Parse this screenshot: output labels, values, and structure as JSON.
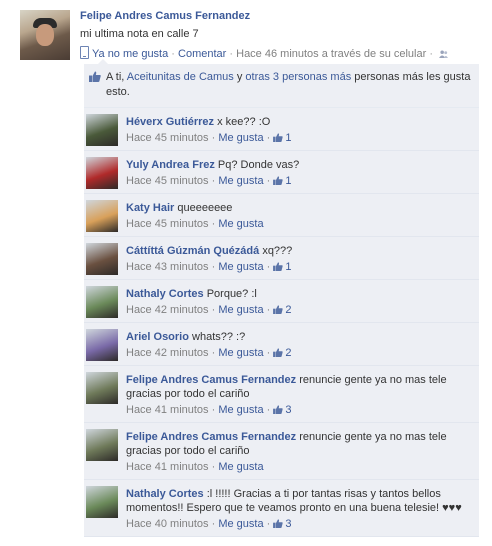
{
  "post": {
    "author": "Felipe Andres Camus Fernandez",
    "text": "mi ultima nota en calle 7",
    "unlike": "Ya no me gusta",
    "comment": "Comentar",
    "time": "Hace 46 minutos a través de su celular",
    "separator": "·"
  },
  "likes": {
    "you": "A ti,",
    "friend": "Aceitunitas de Camus",
    "and": "y",
    "others": "otras 3 personas más",
    "suffix": "personas más les gusta esto."
  },
  "comments": [
    {
      "name": "Héverx Gutiérrez",
      "text": "x kee?? :O",
      "time": "Hace 45 minutos",
      "like": "Me gusta",
      "count": "1",
      "avatar_color": "#4a5a3a"
    },
    {
      "name": "Yuly Andrea Frez",
      "text": "Pq? Donde vas?",
      "time": "Hace 45 minutos",
      "like": "Me gusta",
      "count": "1",
      "avatar_color": "#b02a2a"
    },
    {
      "name": "Katy Hair",
      "text": "queeeeeee",
      "time": "Hace 45 minutos",
      "like": "Me gusta",
      "count": "",
      "avatar_color": "#d8a05a"
    },
    {
      "name": "Cáttíttá Gúzmán Quézádá",
      "text": "xq???",
      "time": "Hace 43 minutos",
      "like": "Me gusta",
      "count": "1",
      "avatar_color": "#6a5040"
    },
    {
      "name": "Nathaly Cortes",
      "text": "Porque? :l",
      "time": "Hace 42 minutos",
      "like": "Me gusta",
      "count": "2",
      "avatar_color": "#6b8a5a"
    },
    {
      "name": "Ariel Osorio",
      "text": "whats?? :?",
      "time": "Hace 42 minutos",
      "like": "Me gusta",
      "count": "2",
      "avatar_color": "#7a6aa8"
    },
    {
      "name": "Felipe Andres Camus Fernandez",
      "text": "renuncie gente ya no mas tele gracias por todo el cariño",
      "time": "Hace 41 minutos",
      "like": "Me gusta",
      "count": "3",
      "avatar_color": "#6f7a5a"
    },
    {
      "name": "Felipe Andres Camus Fernandez",
      "text": "renuncie gente ya no mas tele gracias por todo el cariño",
      "time": "Hace 41 minutos",
      "like": "Me gusta",
      "count": "",
      "avatar_color": "#6f7a5a"
    },
    {
      "name": "Nathaly Cortes",
      "text": ":l !!!!! Gracias a ti por tantas risas y tantos bellos momentos!! Espero que te veamos pronto en una buena telesie! ♥♥♥",
      "time": "Hace 40 minutos",
      "like": "Me gusta",
      "count": "3",
      "avatar_color": "#6b8a5a"
    }
  ]
}
